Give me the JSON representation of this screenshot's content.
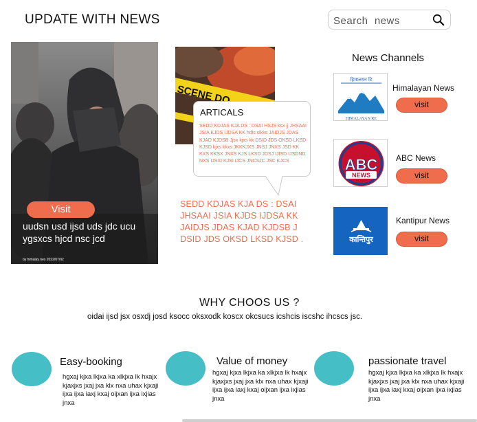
{
  "header": {
    "brand": "UPDATE WITH NEWS",
    "search_placeholder": "Search  news"
  },
  "hero": {
    "button": "Visit",
    "caption": "uudsn usd ijsd uds jdc ucu ygsxcs hjcd nsc jcd",
    "credit": "by himalay nes 2022/07/02"
  },
  "article": {
    "bubble_title": "ARTICALS",
    "bubble_text": "SEDD KDJAS KJA DS : DSAI  HSJS ksx jj JHSAAI JSIA KJDS IJDSA KK hdis slkks JAIDJS JDAS KJAD KJDSB Jjsx kjxs kk DSID JDS OKSD LKSD KJSD  kjxs kkxs JKKKJXS JNSJ JNXS JSD KK KXS KKSX JNXS KJS LKSD JDSJ IJISD IJSDND NXS IJSXI KJSI IJCS JNCSJC JSC KJCS",
    "body": "SEDD KDJAS KJA DS : DSAI JHSAAI JSIA KJDS IJDSA KK JAIDJS JDAS KJAD KJDSB J DSID JDS OKSD LKSD KJSD ."
  },
  "channels": {
    "heading": "News Channels",
    "items": [
      {
        "name": "Himalayan News",
        "button": "visit",
        "logo_text": "हिमालयन टि",
        "logo_sub": "HIMALAYAN RE"
      },
      {
        "name": "ABC News",
        "button": "visit",
        "logo_text": "ABC",
        "logo_sub": "NEWS"
      },
      {
        "name": "Kantipur News",
        "button": "visit",
        "logo_text": "कान्तिपुर"
      }
    ]
  },
  "why": {
    "title": "WHY CHOOS US ?",
    "subtitle": "oidai ijsd jsx osxdj josd ksocc oksxodk koscx okcsucs icshcis iscshc ihcscs jsc.",
    "features": [
      {
        "title": "Easy-booking",
        "text": "hgxaj kjxa lkjxa ka xlkjxa lk hxajx kjaxjxs jxaj jxa klx nxa uhax kjxaji ijxa ijxa iaxj kxaj oijxan ijxa  ixjias  jnxa"
      },
      {
        "title": "Value of money",
        "text": "hgxaj kjxa lkjxa ka xlkjxa lk hxajx kjaxjxs jxaj jxa klx nxa uhax kjxaji ijxa ijxa iaxj kxaj oijxan ijxa  ixjias  jnxa"
      },
      {
        "title": "passionate travel",
        "text": "hgxaj kjxa lkjxa ka xlkjxa lk hxajx kjaxjxs jxaj jxa klx nxa uhax kjxaji ijxa ijxa iaxj kxaj oijxan ijxa  ixjias  jnxa"
      }
    ]
  },
  "colors": {
    "accent": "#ef6c4d",
    "teal": "#46bec6",
    "abc_red": "#c8102e",
    "kantipur_blue": "#1565c0"
  }
}
